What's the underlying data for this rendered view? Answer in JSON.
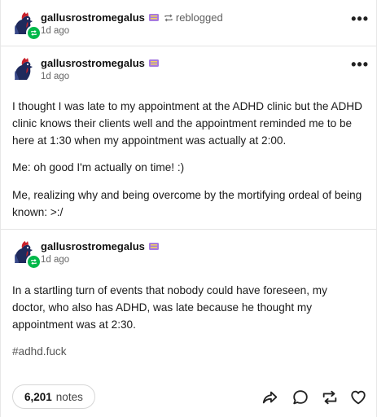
{
  "reblog_header": {
    "username": "gallusrostromegalus",
    "action": "reblogged",
    "time": "1d ago",
    "more_label": "•••"
  },
  "post1": {
    "username": "gallusrostromegalus",
    "time": "1d ago",
    "more_label": "•••",
    "paragraphs": [
      "I thought I was late to my appointment at the ADHD clinic but the ADHD clinic knows their clients well and the appointment reminded me to be here at 1:30 when my appointment was actually at 2:00.",
      "Me: oh good I'm actually on time! :)",
      "Me, realizing why and being overcome by the mortifying ordeal of being known: >:/"
    ]
  },
  "post2": {
    "username": "gallusrostromegalus",
    "time": "1d ago",
    "paragraphs": [
      "In a startling turn of events that nobody could have foreseen, my doctor, who also has ADHD, was late because he thought my appointment was at 2:30."
    ],
    "tag": "#adhd.fuck"
  },
  "footer": {
    "notes_count": "6,201",
    "notes_label": "notes",
    "actions": [
      "share-icon",
      "reply-icon",
      "reblog-icon",
      "like-icon"
    ]
  },
  "colors": {
    "badge_green": "#00b84a",
    "text": "#1a1a1a",
    "muted": "#666666"
  }
}
